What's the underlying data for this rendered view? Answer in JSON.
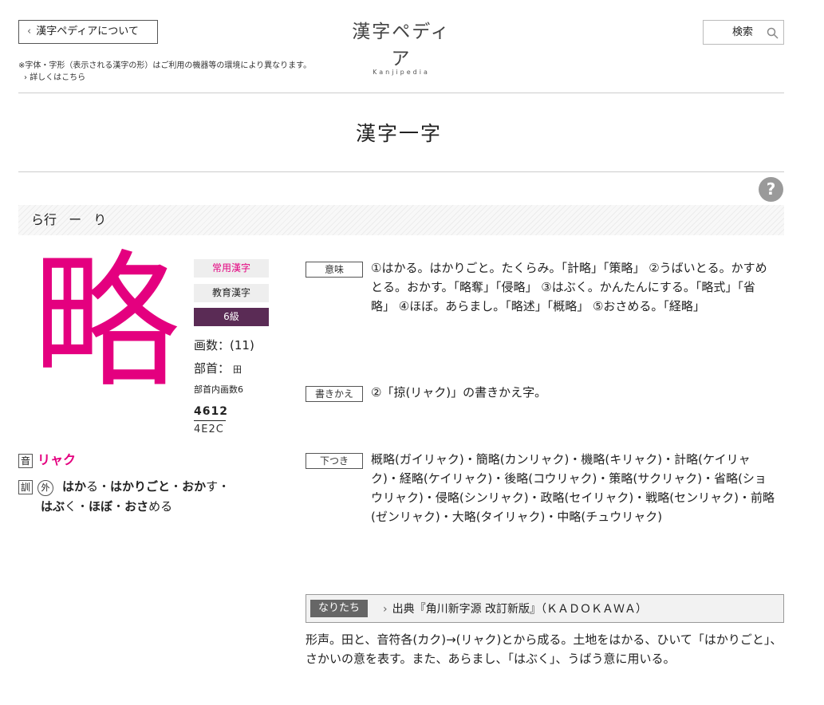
{
  "header": {
    "about_label": "漢字ペディアについて",
    "logo_jp": "漢字ペディア",
    "logo_en": "Kanjipedia",
    "search_label": "検索",
    "note": "※字体・字形（表示される漢字の形）はご利用の機器等の環境により異なります。",
    "note_link": "詳しくはこちら"
  },
  "page_title": "漢字一字",
  "help_label": "?",
  "row_band": [
    "ら行",
    "ー",
    "り"
  ],
  "kanji": {
    "char": "略",
    "tags": [
      "常用漢字",
      "教育漢字",
      "6級"
    ],
    "strokes": "画数：(11)",
    "radical_label": "部首：",
    "radical": "田",
    "radical_inner": "部首内画数6",
    "jis": "4612",
    "unicode": "4E2C",
    "on_label": "音",
    "on_reading": "リャク",
    "kun_label": "訓",
    "kun_outside": "外",
    "kun_lines": [
      [
        {
          "t": "はか",
          "b": true
        },
        {
          "t": "る・",
          "b": false
        },
        {
          "t": "はかりごと",
          "b": true
        },
        {
          "t": "・",
          "b": false
        },
        {
          "t": "おか",
          "b": true
        },
        {
          "t": "す・",
          "b": false
        }
      ],
      [
        {
          "t": "はぶ",
          "b": true
        },
        {
          "t": "く・",
          "b": false
        },
        {
          "t": "ほぼ",
          "b": true
        },
        {
          "t": "・",
          "b": false
        },
        {
          "t": "おさ",
          "b": true
        },
        {
          "t": "める",
          "b": false
        }
      ]
    ]
  },
  "sections": {
    "meaning_label": "意味",
    "meaning_text": "①はかる。はかりごと。たくらみ。「計略」「策略」 ②うばいとる。かすめとる。おかす。「略奪」「侵略」 ③はぶく。かんたんにする。「略式」「省略」 ④ほぼ。あらまし。「略述」「概略」 ⑤おさめる。「経略」",
    "rewrite_label": "書きかえ",
    "rewrite_text": "②「掠(リャク)」の書きかえ字。",
    "shitatsuki_label": "下つき",
    "shitatsuki_text": "概略(ガイリャク)・簡略(カンリャク)・機略(キリャク)・計略(ケイリャク)・経略(ケイリャク)・後略(コウリャク)・策略(サクリャク)・省略(ショウリャク)・侵略(シンリャク)・政略(セイリャク)・戦略(センリャク)・前略(ゼンリャク)・大略(タイリャク)・中略(チュウリャク)",
    "naritachi_label": "なりたち",
    "naritachi_source": "出典『角川新字源 改訂新版』（ＫＡＤＯＫＡＷＡ）",
    "naritachi_text": "形声。田と、音符各(カク)→(リャク)とから成る。土地をはかる、ひいて「はかりごと」、さかいの意を表す。また、あらまし、「はぶく」、うばう意に用いる。"
  }
}
